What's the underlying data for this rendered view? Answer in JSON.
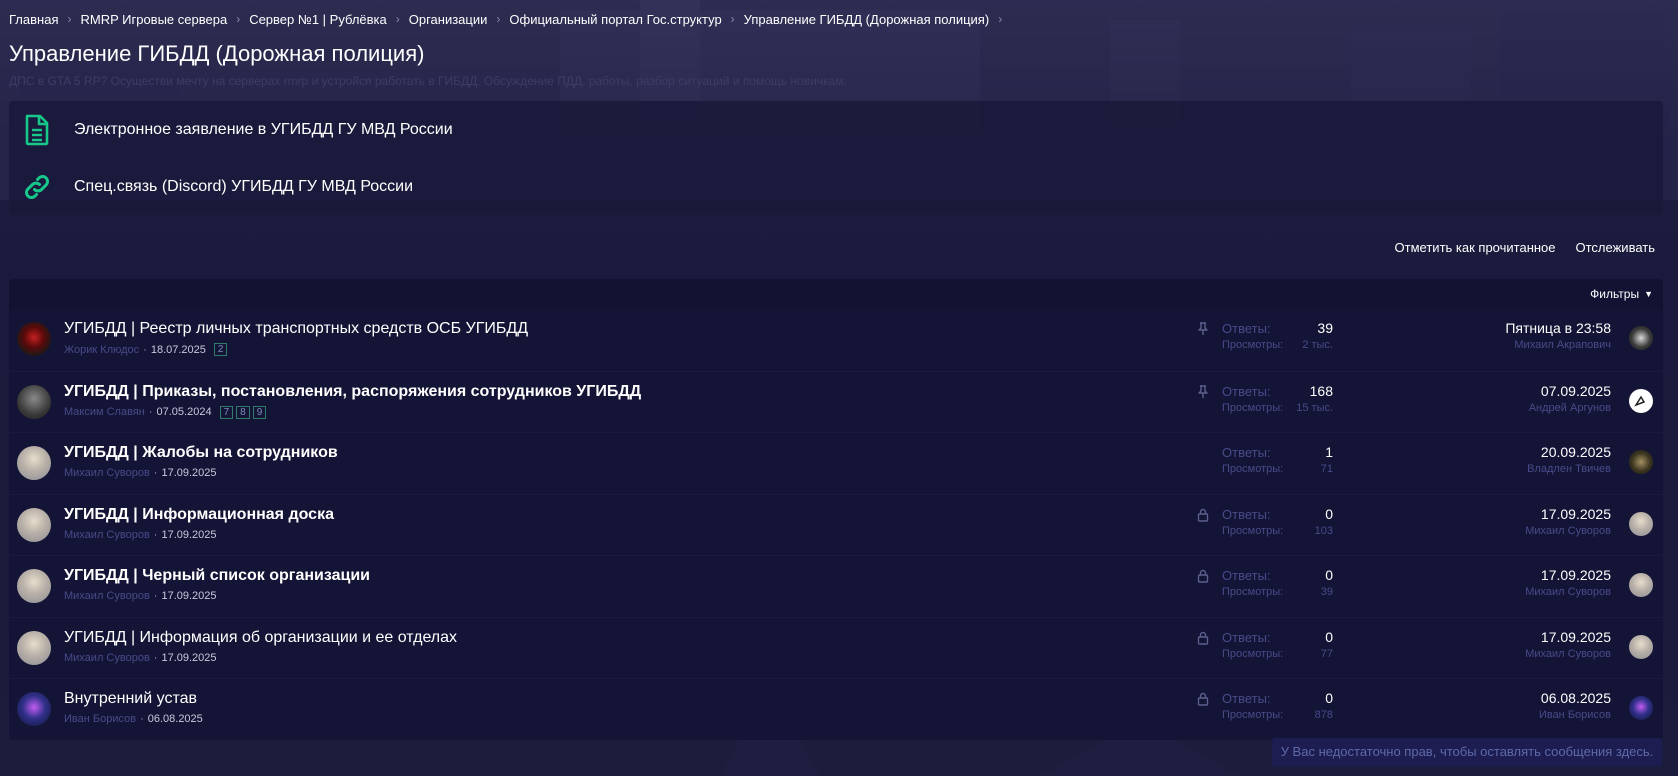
{
  "breadcrumb": [
    {
      "label": "Главная"
    },
    {
      "label": "RMRP Игровые сервера"
    },
    {
      "label": "Сервер №1 | Рублёвка"
    },
    {
      "label": "Организации"
    },
    {
      "label": "Официальный портал Гос.структур"
    },
    {
      "label": "Управление ГИБДД (Дорожная полиция)"
    }
  ],
  "page": {
    "title": "Управление ГИБДД (Дорожная полиция)",
    "description": "ДПС в GTA 5 RP? Осуществи мечту на серверах rmrp и устройся работать в ГИБДД. Обсуждение ПДД, работы, разбор ситуаций и помощь новичкам."
  },
  "links": [
    {
      "label": "Электронное заявление в УГИБДД ГУ МВД России",
      "icon": "document-icon"
    },
    {
      "label": "Спец.связь (Discord) УГИБДД ГУ МВД России",
      "icon": "link-icon"
    }
  ],
  "actions": {
    "mark_read": "Отметить как прочитанное",
    "watch": "Отслеживать"
  },
  "filters_label": "Фильтры",
  "stat_labels": {
    "replies": "Ответы:",
    "views": "Просмотры:"
  },
  "threads": [
    {
      "title": "УГИБДД | Реестр личных транспортных средств ОСБ УГИБДД",
      "bold": false,
      "author": "Жорик Клюдос",
      "date": "18.07.2025",
      "pages": [
        "2"
      ],
      "status_icon": "pin-icon",
      "replies": "39",
      "views": "2 тыс.",
      "last_date": "Пятница в 23:58",
      "last_user": "Михаил Акрапович"
    },
    {
      "title": "УГИБДД | Приказы, постановления, распоряжения сотрудников УГИБДД",
      "bold": true,
      "author": "Максим Славян",
      "date": "07.05.2024",
      "pages": [
        "7",
        "8",
        "9"
      ],
      "status_icon": "pin-icon",
      "replies": "168",
      "views": "15 тыс.",
      "last_date": "07.09.2025",
      "last_user": "Андрей Аргунов"
    },
    {
      "title": "УГИБДД | Жалобы на сотрудников",
      "bold": true,
      "author": "Михаил Суворов",
      "date": "17.09.2025",
      "pages": [],
      "status_icon": "",
      "replies": "1",
      "views": "71",
      "last_date": "20.09.2025",
      "last_user": "Владлен Твичев"
    },
    {
      "title": "УГИБДД | Информационная доска",
      "bold": true,
      "author": "Михаил Суворов",
      "date": "17.09.2025",
      "pages": [],
      "status_icon": "lock-icon",
      "replies": "0",
      "views": "103",
      "last_date": "17.09.2025",
      "last_user": "Михаил Суворов"
    },
    {
      "title": "УГИБДД | Черный список организации",
      "bold": true,
      "author": "Михаил Суворов",
      "date": "17.09.2025",
      "pages": [],
      "status_icon": "lock-icon",
      "replies": "0",
      "views": "39",
      "last_date": "17.09.2025",
      "last_user": "Михаил Суворов"
    },
    {
      "title": "УГИБДД | Информация об организации и ее отделах",
      "bold": false,
      "author": "Михаил Суворов",
      "date": "17.09.2025",
      "pages": [],
      "status_icon": "lock-icon",
      "replies": "0",
      "views": "77",
      "last_date": "17.09.2025",
      "last_user": "Михаил Суворов"
    },
    {
      "title": "Внутренний устав",
      "bold": false,
      "author": "Иван Борисов",
      "date": "06.08.2025",
      "pages": [],
      "status_icon": "lock-icon",
      "replies": "0",
      "views": "878",
      "last_date": "06.08.2025",
      "last_user": "Иван Борисов"
    }
  ],
  "notice": "У Вас недостаточно прав, чтобы оставлять сообщения здесь.",
  "colors": {
    "accent_green": "#16c98a",
    "muted_link": "#4a4a8a",
    "background": "#1a1a3c"
  }
}
